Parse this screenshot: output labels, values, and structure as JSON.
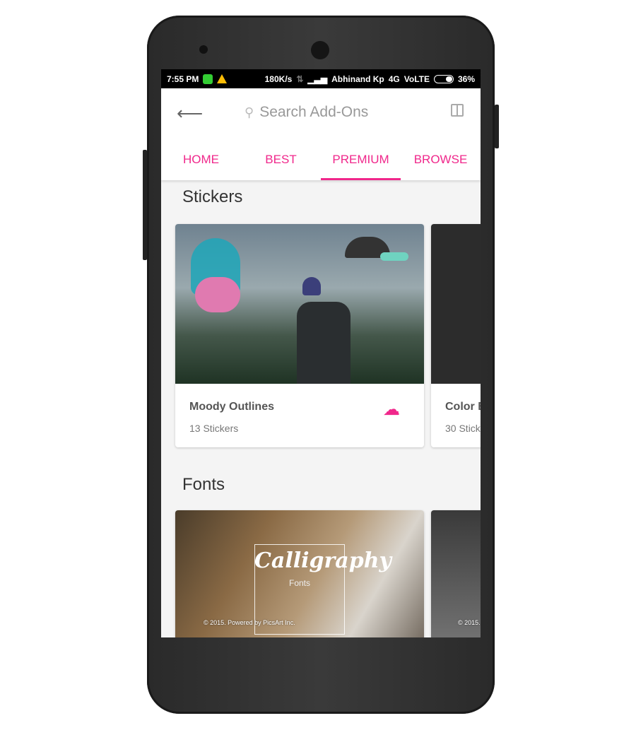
{
  "status_bar": {
    "time": "7:55 PM",
    "speed": "180K/s",
    "carrier": "Abhinand Kp",
    "network": "4G",
    "volte": "VoLTE",
    "battery": "36%",
    "battery_level": 0.36
  },
  "header": {
    "search_placeholder": "Search Add-Ons",
    "back_icon": "arrow-left-icon",
    "gift_icon": "gift-icon"
  },
  "tabs": [
    {
      "label": "HOME"
    },
    {
      "label": "BEST"
    },
    {
      "label": "PREMIUM",
      "active": true
    },
    {
      "label": "BROWSE"
    }
  ],
  "accent": "#f0278b",
  "sections": {
    "stickers": {
      "title": "Stickers",
      "cards": [
        {
          "title": "Moody Outlines",
          "subtitle": "13 Stickers"
        },
        {
          "title": "Color B",
          "subtitle": "30 Stick"
        }
      ]
    },
    "fonts": {
      "title": "Fonts",
      "cards": [
        {
          "title": "Calligraphy",
          "subtitle": "Fonts",
          "credit": "© 2015. Powered by PicsArt Inc."
        },
        {
          "credit": "© 2015. P"
        }
      ]
    }
  }
}
